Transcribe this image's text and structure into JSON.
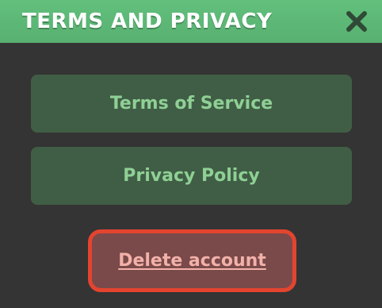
{
  "header": {
    "title": "TERMS AND PRIVACY",
    "close_icon": "close-icon"
  },
  "menu": {
    "terms_label": "Terms of Service",
    "privacy_label": "Privacy Policy",
    "delete_label": "Delete account"
  },
  "colors": {
    "header_bg": "#5cb676",
    "panel_bg": "#343434",
    "button_bg": "#405e45",
    "button_text": "#8fd095",
    "delete_border": "#e4442f",
    "delete_bg": "#7a4a4a",
    "delete_text": "#f2b1a9"
  }
}
